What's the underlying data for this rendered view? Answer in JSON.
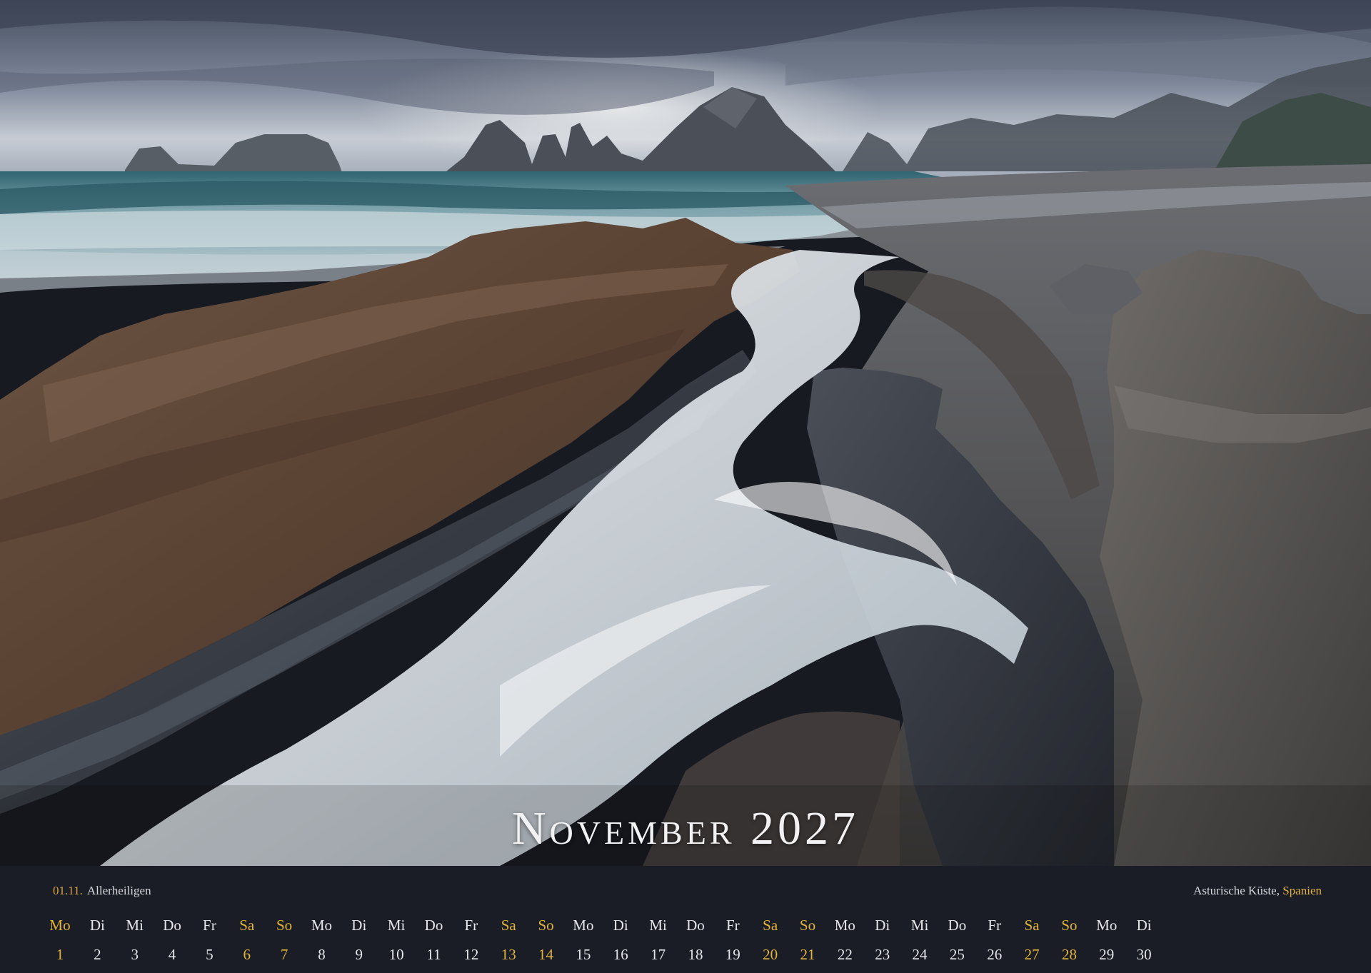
{
  "page": {
    "title": "November 2027",
    "holiday": {
      "date": "01.11.",
      "name": "Allerheiligen"
    },
    "location": {
      "place": "Asturische Küste,",
      "country": "Spanien"
    }
  },
  "calendar": {
    "days": [
      {
        "wd": "Mo",
        "d": "1",
        "we": true
      },
      {
        "wd": "Di",
        "d": "2",
        "we": false
      },
      {
        "wd": "Mi",
        "d": "3",
        "we": false
      },
      {
        "wd": "Do",
        "d": "4",
        "we": false
      },
      {
        "wd": "Fr",
        "d": "5",
        "we": false
      },
      {
        "wd": "Sa",
        "d": "6",
        "we": true
      },
      {
        "wd": "So",
        "d": "7",
        "we": true
      },
      {
        "wd": "Mo",
        "d": "8",
        "we": false
      },
      {
        "wd": "Di",
        "d": "9",
        "we": false
      },
      {
        "wd": "Mi",
        "d": "10",
        "we": false
      },
      {
        "wd": "Do",
        "d": "11",
        "we": false
      },
      {
        "wd": "Fr",
        "d": "12",
        "we": false
      },
      {
        "wd": "Sa",
        "d": "13",
        "we": true
      },
      {
        "wd": "So",
        "d": "14",
        "we": true
      },
      {
        "wd": "Mo",
        "d": "15",
        "we": false
      },
      {
        "wd": "Di",
        "d": "16",
        "we": false
      },
      {
        "wd": "Mi",
        "d": "17",
        "we": false
      },
      {
        "wd": "Do",
        "d": "18",
        "we": false
      },
      {
        "wd": "Fr",
        "d": "19",
        "we": false
      },
      {
        "wd": "Sa",
        "d": "20",
        "we": true
      },
      {
        "wd": "So",
        "d": "21",
        "we": true
      },
      {
        "wd": "Mo",
        "d": "22",
        "we": false
      },
      {
        "wd": "Di",
        "d": "23",
        "we": false
      },
      {
        "wd": "Mi",
        "d": "24",
        "we": false
      },
      {
        "wd": "Do",
        "d": "25",
        "we": false
      },
      {
        "wd": "Fr",
        "d": "26",
        "we": false
      },
      {
        "wd": "Sa",
        "d": "27",
        "we": true
      },
      {
        "wd": "So",
        "d": "28",
        "we": true
      },
      {
        "wd": "Mo",
        "d": "29",
        "we": false
      },
      {
        "wd": "Di",
        "d": "30",
        "we": false
      }
    ]
  },
  "colors": {
    "accent": "#e2b43a",
    "strip_background": "#1b1d26",
    "text": "#e6e6ea"
  }
}
